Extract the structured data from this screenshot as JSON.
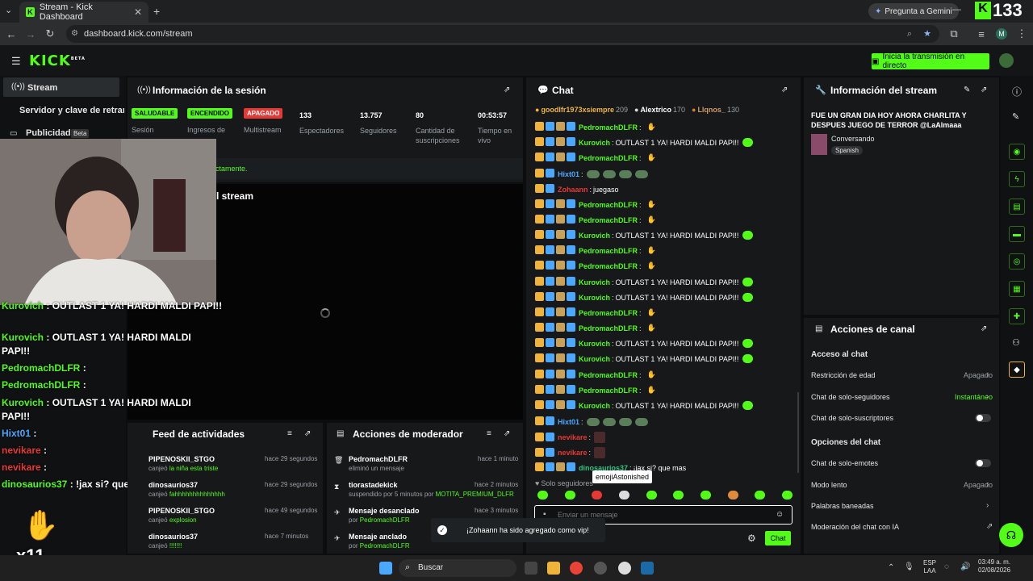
{
  "browser": {
    "tab_title": "Stream - Kick Dashboard",
    "url": "dashboard.kick.com/stream",
    "gemini_label": "Pregunta a Gemini",
    "viewer_overlay": "133",
    "profile_letter": "M"
  },
  "header": {
    "logo": "KICK",
    "logo_beta": "BETA",
    "go_live": "Inicia la transmisión en directo"
  },
  "sidebar": {
    "items": [
      {
        "label": "Stream"
      },
      {
        "label": "Servidor y clave de retransmisión"
      },
      {
        "label": "Publicidad",
        "badge": "Beta"
      }
    ]
  },
  "session": {
    "title": "Información de la sesión",
    "badges": [
      {
        "text": "SALUDABLE",
        "label": "Sesión",
        "color": "#53fc18"
      },
      {
        "text": "ENCENDIDO",
        "label": "Ingresos de",
        "color": "#53fc18"
      },
      {
        "text": "APAGADO",
        "label": "Multistream",
        "color": "#e53935"
      }
    ],
    "stats": [
      {
        "value": "133",
        "label": "Espectadores"
      },
      {
        "value": "13.757",
        "label": "Seguidores"
      },
      {
        "value": "80",
        "label": "Cantidad de suscripciones"
      },
      {
        "value": "00:53:57",
        "label": "Tiempo en vivo"
      }
    ],
    "notice": "ectamente.",
    "preview_title": "l stream"
  },
  "chat": {
    "title": "Chat",
    "pinned": [
      {
        "user": "goodlfr1973xsiempre",
        "count": "209"
      },
      {
        "user": "Alextrico",
        "count": "170"
      },
      {
        "user": "Llqnos_",
        "count": "130"
      }
    ],
    "messages": [
      {
        "user": "PedromachDLFR",
        "cls": "u-ped",
        "text": ""
      },
      {
        "user": "Kurovich",
        "cls": "u-kur",
        "text": "OUTLAST 1 YA! HARDI MALDI PAPI!!"
      },
      {
        "user": "PedromachDLFR",
        "cls": "u-ped",
        "text": ""
      },
      {
        "user": "Hixt01",
        "cls": "u-hix",
        "text": ""
      },
      {
        "user": "Zohaann",
        "cls": "u-red",
        "text": "juegaso"
      },
      {
        "user": "PedromachDLFR",
        "cls": "u-ped",
        "text": ""
      },
      {
        "user": "PedromachDLFR",
        "cls": "u-ped",
        "text": ""
      },
      {
        "user": "Kurovich",
        "cls": "u-kur",
        "text": "OUTLAST 1 YA! HARDI MALDI PAPI!!"
      },
      {
        "user": "PedromachDLFR",
        "cls": "u-ped",
        "text": ""
      },
      {
        "user": "PedromachDLFR",
        "cls": "u-ped",
        "text": ""
      },
      {
        "user": "Kurovich",
        "cls": "u-kur",
        "text": "OUTLAST 1 YA! HARDI MALDI PAPI!!"
      },
      {
        "user": "Kurovich",
        "cls": "u-kur",
        "text": "OUTLAST 1 YA! HARDI MALDI PAPI!!"
      },
      {
        "user": "PedromachDLFR",
        "cls": "u-ped",
        "text": ""
      },
      {
        "user": "PedromachDLFR",
        "cls": "u-ped",
        "text": ""
      },
      {
        "user": "Kurovich",
        "cls": "u-kur",
        "text": "OUTLAST 1 YA! HARDI MALDI PAPI!!"
      },
      {
        "user": "Kurovich",
        "cls": "u-kur",
        "text": "OUTLAST 1 YA! HARDI MALDI PAPI!!"
      },
      {
        "user": "PedromachDLFR",
        "cls": "u-ped",
        "text": ""
      },
      {
        "user": "PedromachDLFR",
        "cls": "u-ped",
        "text": ""
      },
      {
        "user": "Kurovich",
        "cls": "u-kur",
        "text": "OUTLAST 1 YA! HARDI MALDI PAPI!!"
      },
      {
        "user": "Hixt01",
        "cls": "u-hix",
        "text": ""
      },
      {
        "user": "nevikare",
        "cls": "u-red",
        "text": ""
      },
      {
        "user": "nevikare",
        "cls": "u-red",
        "text": ""
      },
      {
        "user": "dinosaurios37",
        "cls": "u-dino",
        "text": "¡jax si? que mas"
      }
    ],
    "followers_only": "Solo seguidores",
    "tooltip": "emojiAstonished",
    "input_placeholder": "Enviar un mensaje",
    "send_label": "Chat"
  },
  "stream_info": {
    "title": "Información del stream",
    "stream_title": "FUE UN GRAN DIA HOY AHORA CHARLITA Y DESPUES JUEGO DE TERROR @LaAlmaaa",
    "category": "Conversando",
    "language": "Spanish"
  },
  "channel_actions": {
    "title": "Acciones de canal",
    "section1": "Acceso al chat",
    "rows1": [
      {
        "label": "Restricción de edad",
        "value": "Apagado",
        "type": "chevron"
      },
      {
        "label": "Chat de solo-seguidores",
        "value": "Instantáneo",
        "type": "chevron"
      },
      {
        "label": "Chat de solo-suscriptores",
        "value": "",
        "type": "toggle"
      }
    ],
    "section2": "Opciones del chat",
    "rows2": [
      {
        "label": "Chat de solo-emotes",
        "value": "",
        "type": "toggle"
      },
      {
        "label": "Modo lento",
        "value": "Apagado",
        "type": "chevron"
      },
      {
        "label": "Palabras baneadas",
        "value": "",
        "type": "chevron"
      },
      {
        "label": "Moderación del chat con IA",
        "value": "",
        "type": "external"
      }
    ]
  },
  "activity": {
    "title": "Feed de actividades",
    "items": [
      {
        "user": "PIPENOSKII_STGO",
        "action": "canjeó",
        "item": "la niña esta triste",
        "time": "hace 29 segundos"
      },
      {
        "user": "dinosaurios37",
        "action": "canjeó",
        "item": "fahhhhhhhhhhhhhh",
        "time": "hace 29 segundos"
      },
      {
        "user": "PIPENOSKII_STGO",
        "action": "canjeó",
        "item": "explosion",
        "time": "hace 49 segundos"
      },
      {
        "user": "dinosaurios37",
        "action": "canjeó",
        "item": "!!!!!!!",
        "time": "hace 7 minutos"
      }
    ]
  },
  "mod_actions": {
    "title": "Acciones de moderador",
    "items": [
      {
        "title": "PedromachDLFR",
        "sub": "eliminó un mensaje",
        "time": "hace 1 minuto"
      },
      {
        "title": "tiorastadekick",
        "sub": "suspendido por 5 minutos por",
        "who": "MOTITA_PREMIUM_DLFR",
        "time": "hace 2 minutos"
      },
      {
        "title": "Mensaje desanclado",
        "sub": "por",
        "who": "PedromachDLFR",
        "time": "hace 3 minutos"
      },
      {
        "title": "Mensaje anclado",
        "sub": "por",
        "who": "PedromachDLFR",
        "time": ""
      }
    ]
  },
  "toast": "¡Zohaann ha sido agregado como vip!",
  "overlay_chat": [
    {
      "user": "Kurovich",
      "text": ": OUTLAST 1 YA! HARDI MALDI PAPI!!"
    },
    {
      "user": "Kurovich",
      "text": ": OUTLAST 1 YA! HARDI MALDI PAPI!!"
    },
    {
      "user": "PedromachDLFR",
      "text": ":"
    },
    {
      "user": "PedromachDLFR",
      "text": ":"
    },
    {
      "user": "Kurovich",
      "text": ": OUTLAST 1 YA! HARDI MALDI PAPI!!"
    },
    {
      "user": "Hixt01",
      "text": ":"
    },
    {
      "user": "nevikare",
      "text": ":"
    },
    {
      "user": "nevikare",
      "text": ":"
    },
    {
      "user": "dinosaurios37",
      "text": ": !jax si? que mas"
    }
  ],
  "overlay_counter": "x11",
  "taskbar": {
    "search": "Buscar",
    "lang": "ESP",
    "lang2": "LAA",
    "time": "03:49 a. m.",
    "date": "02/08/2026"
  }
}
